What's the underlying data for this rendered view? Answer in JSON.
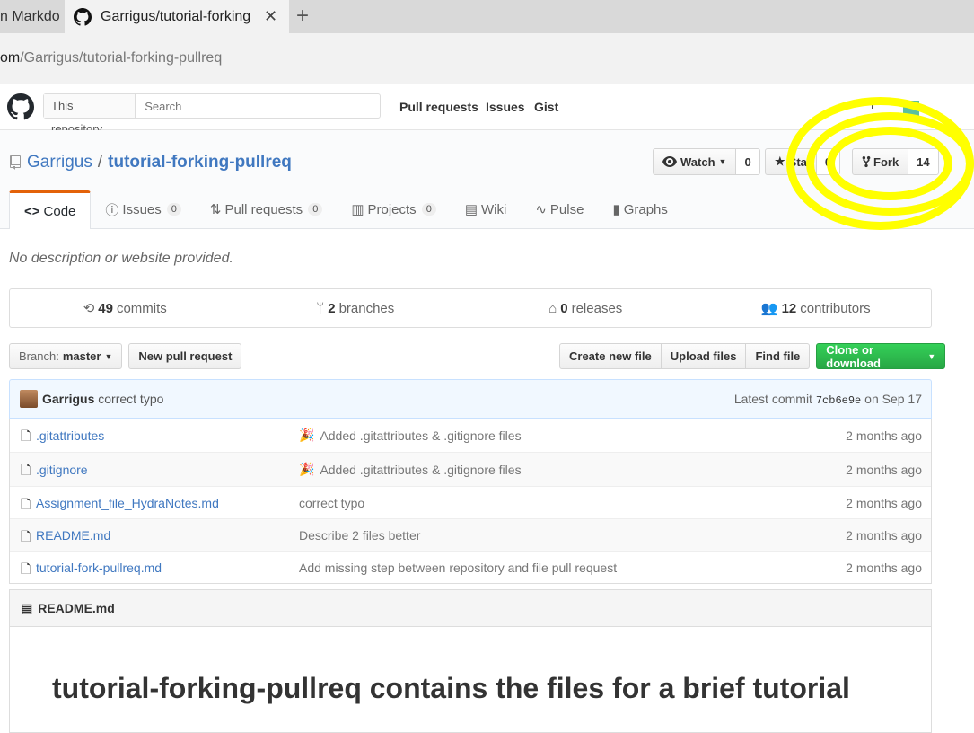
{
  "browser": {
    "inactive_tab": "n Markdo",
    "active_tab": "Garrigus/tutorial-forking",
    "url_host": "om",
    "url_path": "/Garrigus/tutorial-forking-pullreq"
  },
  "github_header": {
    "search_scope": "This repository",
    "search_placeholder": "Search",
    "nav": [
      "Pull requests",
      "Issues",
      "Gist"
    ],
    "plus_label": "+"
  },
  "repo": {
    "owner": "Garrigus",
    "separator": "/",
    "name": "tutorial-forking-pullreq",
    "watch_label": "Watch",
    "watch_count": "0",
    "star_label": "Sta",
    "star_count": "0",
    "fork_label": "Fork",
    "fork_count": "14"
  },
  "tabs": [
    {
      "label": "Code",
      "counter": ""
    },
    {
      "label": "Issues",
      "counter": "0"
    },
    {
      "label": "Pull requests",
      "counter": "0"
    },
    {
      "label": "Projects",
      "counter": "0"
    },
    {
      "label": "Wiki",
      "counter": ""
    },
    {
      "label": "Pulse",
      "counter": ""
    },
    {
      "label": "Graphs",
      "counter": ""
    }
  ],
  "description": "No description or website provided.",
  "summary": {
    "commits_num": "49",
    "commits_label": "commits",
    "branches_num": "2",
    "branches_label": "branches",
    "releases_num": "0",
    "releases_label": "releases",
    "contributors_num": "12",
    "contributors_label": "contributors"
  },
  "toolbar": {
    "branch_prefix": "Branch:",
    "branch_name": "master",
    "new_pr": "New pull request",
    "create_file": "Create new file",
    "upload_files": "Upload files",
    "find_file": "Find file",
    "clone": "Clone or download"
  },
  "commit": {
    "author": "Garrigus",
    "message": "correct typo",
    "latest_prefix": "Latest commit",
    "sha": "7cb6e9e",
    "date": "on Sep 17"
  },
  "files": [
    {
      "name": ".gitattributes",
      "message": "Added .gitattributes & .gitignore files",
      "age": "2 months ago",
      "emoji": true
    },
    {
      "name": ".gitignore",
      "message": "Added .gitattributes & .gitignore files",
      "age": "2 months ago",
      "emoji": true
    },
    {
      "name": "Assignment_file_HydraNotes.md",
      "message": "correct typo",
      "age": "2 months ago",
      "emoji": false
    },
    {
      "name": "README.md",
      "message": "Describe 2 files better",
      "age": "2 months ago",
      "emoji": false
    },
    {
      "name": "tutorial-fork-pullreq.md",
      "message": "Add missing step between repository and file pull request",
      "age": "2 months ago",
      "emoji": false
    }
  ],
  "readme": {
    "header": "README.md",
    "title": "tutorial-forking-pullreq contains the files for a brief tutorial"
  },
  "colors": {
    "annotation": "#ffff00",
    "link": "#4078c0",
    "green": "#28a745"
  }
}
